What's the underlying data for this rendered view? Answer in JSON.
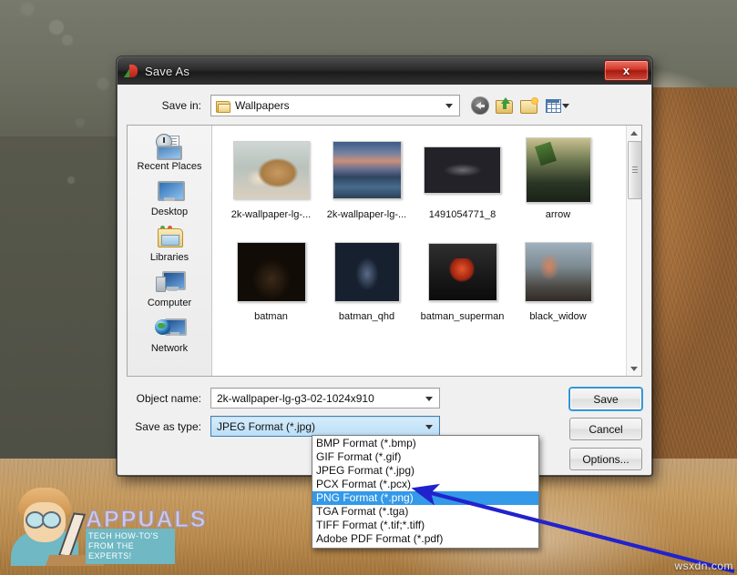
{
  "window": {
    "title": "Save As",
    "title_icon": "irfanview-icon",
    "close_label": "x"
  },
  "savein": {
    "label": "Save in:",
    "value": "Wallpapers",
    "folder_icon": "folder-icon",
    "dropdown_icon": "chevron-down-icon"
  },
  "toolbar": {
    "back": "back-arrow-icon",
    "up": "up-one-level-icon",
    "new_folder": "new-folder-icon",
    "views": "views-icon",
    "views_caret": "chevron-down-icon"
  },
  "places": [
    {
      "label": "Recent Places",
      "icon": "recent-places-icon"
    },
    {
      "label": "Desktop",
      "icon": "desktop-icon"
    },
    {
      "label": "Libraries",
      "icon": "libraries-icon"
    },
    {
      "label": "Computer",
      "icon": "computer-icon"
    },
    {
      "label": "Network",
      "icon": "network-icon"
    }
  ],
  "files": [
    {
      "label": "2k-wallpaper-lg-...",
      "art": "t-lion"
    },
    {
      "label": "2k-wallpaper-lg-...",
      "art": "t-city"
    },
    {
      "label": "1491054771_8",
      "art": "t-dark"
    },
    {
      "label": "arrow",
      "art": "t-arrow"
    },
    {
      "label": "batman",
      "art": "t-batman"
    },
    {
      "label": "batman_qhd",
      "art": "t-batqhd"
    },
    {
      "label": "batman_superman",
      "art": "t-bsup"
    },
    {
      "label": "black_widow",
      "art": "t-bw"
    }
  ],
  "form": {
    "objectname_label": "Object name:",
    "objectname_value": "2k-wallpaper-lg-g3-02-1024x910",
    "savetype_label": "Save as type:",
    "savetype_value": "JPEG Format (*.jpg)"
  },
  "buttons": {
    "save": "Save",
    "cancel": "Cancel",
    "options": "Options..."
  },
  "type_options": [
    {
      "label": "BMP Format (*.bmp)",
      "selected": false
    },
    {
      "label": "GIF Format (*.gif)",
      "selected": false
    },
    {
      "label": "JPEG Format (*.jpg)",
      "selected": false
    },
    {
      "label": "PCX Format (*.pcx)",
      "selected": false
    },
    {
      "label": "PNG Format (*.png)",
      "selected": true
    },
    {
      "label": "TGA Format (*.tga)",
      "selected": false
    },
    {
      "label": "TIFF Format (*.tif;*.tiff)",
      "selected": false
    },
    {
      "label": "Adobe PDF Format (*.pdf)",
      "selected": false
    }
  ],
  "annotation": {
    "arrow_color": "#2222cc",
    "points_to": "PNG Format (*.png)"
  },
  "watermark": {
    "brand": "APPUALS",
    "tagline": "TECH HOW-TO'S FROM THE EXPERTS!"
  },
  "credit": "wsxdn.com",
  "colors": {
    "selection_blue": "#3399e8",
    "focus_blue": "#3ba3e0",
    "close_red": "#d63b2c"
  }
}
